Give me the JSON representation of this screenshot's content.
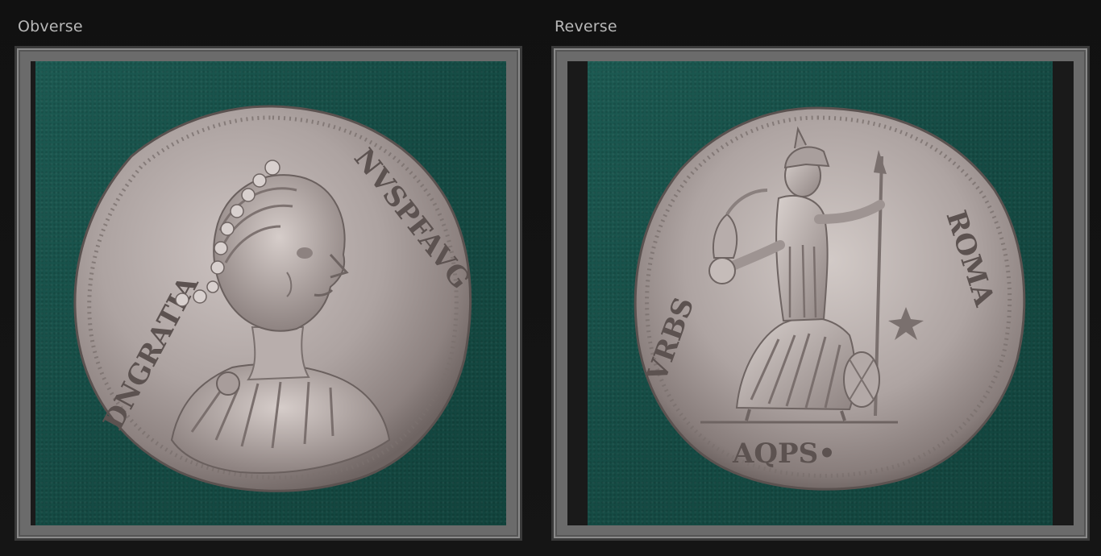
{
  "panels": {
    "obverse": {
      "title": "Obverse"
    },
    "reverse": {
      "title": "Reverse"
    }
  },
  "images": {
    "obverse": {
      "subject": "silver siliqua obverse, diademed draped bust right",
      "background_color": "#175048"
    },
    "reverse": {
      "subject": "silver siliqua reverse, seated Roma holding Victory and spear",
      "background_color": "#175048"
    }
  },
  "colors": {
    "page_background": "#111111",
    "frame": "#6b6b6b",
    "title_text": "#b8b8b8",
    "coin_silver": "#b9b0ae"
  }
}
